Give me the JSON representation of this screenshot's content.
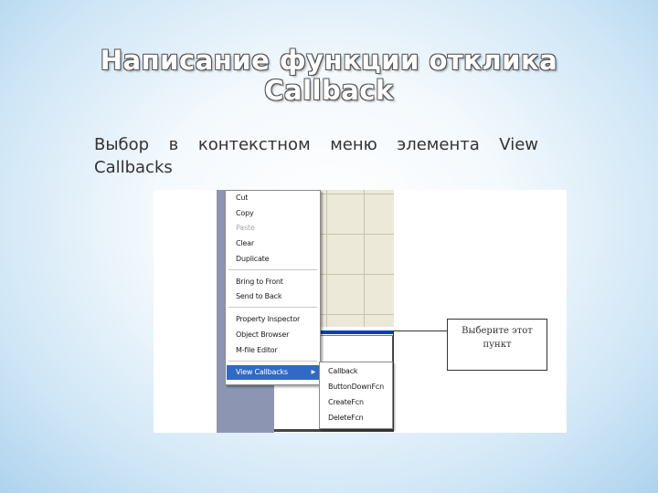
{
  "slide": {
    "title_line1": "Написание функции отклика",
    "title_line2": "Callback",
    "body": "Выбор в контекстном меню элемента View Callbacks"
  },
  "context_menu": {
    "items": [
      {
        "label": "Cut",
        "disabled": false
      },
      {
        "label": "Copy",
        "disabled": false
      },
      {
        "label": "Paste",
        "disabled": true
      },
      {
        "label": "Clear",
        "disabled": false
      },
      {
        "label": "Duplicate",
        "disabled": false
      },
      {
        "label": "Bring to Front",
        "disabled": false
      },
      {
        "label": "Send to Back",
        "disabled": false
      },
      {
        "label": "Property Inspector",
        "disabled": false
      },
      {
        "label": "Object Browser",
        "disabled": false
      },
      {
        "label": "M-file Editor",
        "disabled": false
      },
      {
        "label": "View Callbacks",
        "disabled": false,
        "highlighted": true,
        "has_submenu": true
      }
    ],
    "submenu_arrow": "▶"
  },
  "submenu": {
    "items": [
      "Callback",
      "ButtonDownFcn",
      "CreateFcn",
      "DeleteFcn"
    ]
  },
  "callout": {
    "text_line1": "Выберите этот",
    "text_line2": "пункт"
  },
  "colors": {
    "highlight": "#316ac5",
    "selection_bar": "#0a3fb7",
    "panel_gray": "#8c96b3"
  }
}
